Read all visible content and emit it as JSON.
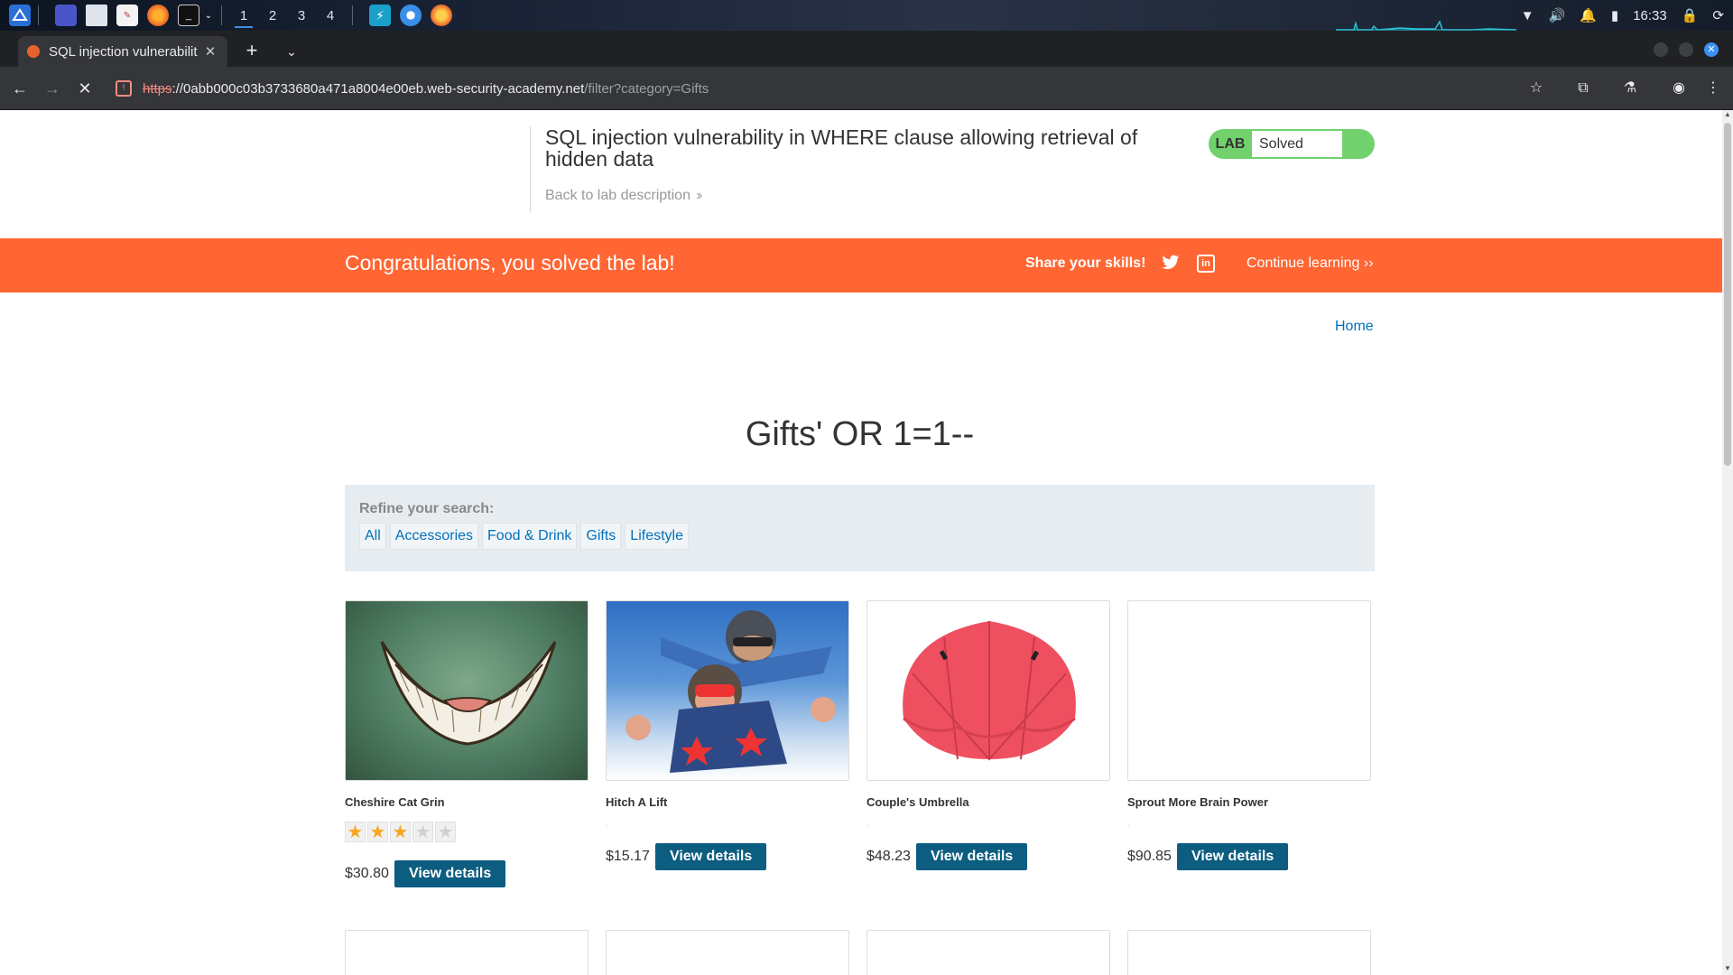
{
  "taskbar": {
    "workspaces": [
      "1",
      "2",
      "3",
      "4"
    ],
    "active_workspace": "1",
    "clock": "16:33",
    "icons": [
      "app-menu-icon",
      "desktop-icon",
      "files-icon",
      "pdf-icon",
      "firefox-icon",
      "terminal-icon",
      "burp-icon",
      "chromium-icon",
      "notification-app-icon"
    ]
  },
  "browser": {
    "tab_title": "SQL injection vulnerabilit",
    "url_scheme": "https",
    "url_host": "://0abb000c03b3733680a471a8004e00eb.web-security-academy.net",
    "url_path": "/filter?category=Gifts"
  },
  "lab": {
    "title": "SQL injection vulnerability in WHERE clause allowing retrieval of hidden data",
    "back_link": "Back to lab description",
    "status_label": "LAB",
    "status_value": "Solved",
    "status_color": "#70d16d"
  },
  "banner": {
    "message": "Congratulations, you solved the lab!",
    "share": "Share your skills!",
    "continue": "Continue learning",
    "color": "#ff6633"
  },
  "nav": {
    "home": "Home"
  },
  "heading": "Gifts' OR 1=1--",
  "refine": {
    "label": "Refine your search:",
    "categories": [
      "All",
      "Accessories",
      "Food & Drink",
      "Gifts",
      "Lifestyle"
    ]
  },
  "products": [
    {
      "name": "Cheshire Cat Grin",
      "price": "$30.80",
      "rating": 3,
      "button": "View details"
    },
    {
      "name": "Hitch A Lift",
      "price": "$15.17",
      "button": "View details"
    },
    {
      "name": "Couple's Umbrella",
      "price": "$48.23",
      "button": "View details"
    },
    {
      "name": "Sprout More Brain Power",
      "price": "$90.85",
      "button": "View details"
    }
  ]
}
